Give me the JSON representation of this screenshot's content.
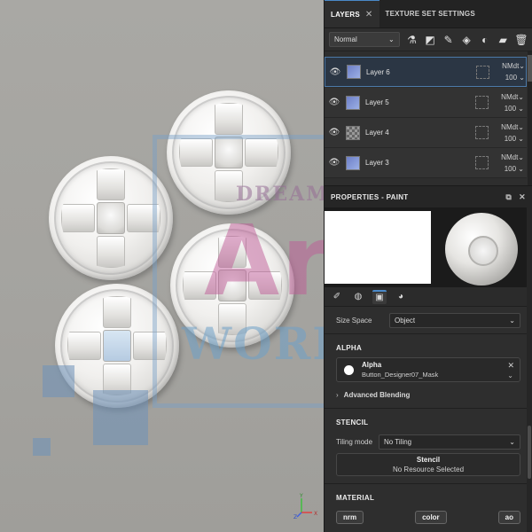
{
  "layers_panel": {
    "tab_layers": "LAYERS",
    "tab_close": "✕",
    "tab_texture": "TEXTURE SET SETTINGS",
    "blend_mode": "Normal",
    "layers": [
      {
        "name": "Layer 6",
        "blend": "NMdt",
        "opacity": "100",
        "selected": true,
        "thumb": "blue"
      },
      {
        "name": "Layer 5",
        "blend": "NMdt",
        "opacity": "100",
        "selected": false,
        "thumb": "blue"
      },
      {
        "name": "Layer 4",
        "blend": "NMdt",
        "opacity": "100",
        "selected": false,
        "thumb": "checker"
      },
      {
        "name": "Layer 3",
        "blend": "NMdt",
        "opacity": "100",
        "selected": false,
        "thumb": "blue"
      }
    ]
  },
  "properties": {
    "title": "PROPERTIES - PAINT",
    "size_space_label": "Size Space",
    "size_space_value": "Object",
    "alpha_section": "ALPHA",
    "alpha_title": "Alpha",
    "alpha_resource": "Button_Designer07_Mask",
    "advanced_blending": "Advanced Blending",
    "stencil_section": "STENCIL",
    "tiling_mode_label": "Tiling mode",
    "tiling_mode_value": "No Tiling",
    "stencil_title": "Stencil",
    "stencil_status": "No Resource Selected",
    "material_section": "MATERIAL",
    "material_buttons": [
      "nrm",
      "color",
      "ao"
    ]
  },
  "watermark": {
    "line1": "DREAMY",
    "line2": "Art",
    "line3": "WORLD"
  },
  "gizmo": {
    "y": "Y",
    "x": "X",
    "z": "Z"
  },
  "colors": {
    "panel_bg": "#2e2e2e",
    "accent": "#4a89c8",
    "viewport_bg": "#a6a5a1"
  }
}
